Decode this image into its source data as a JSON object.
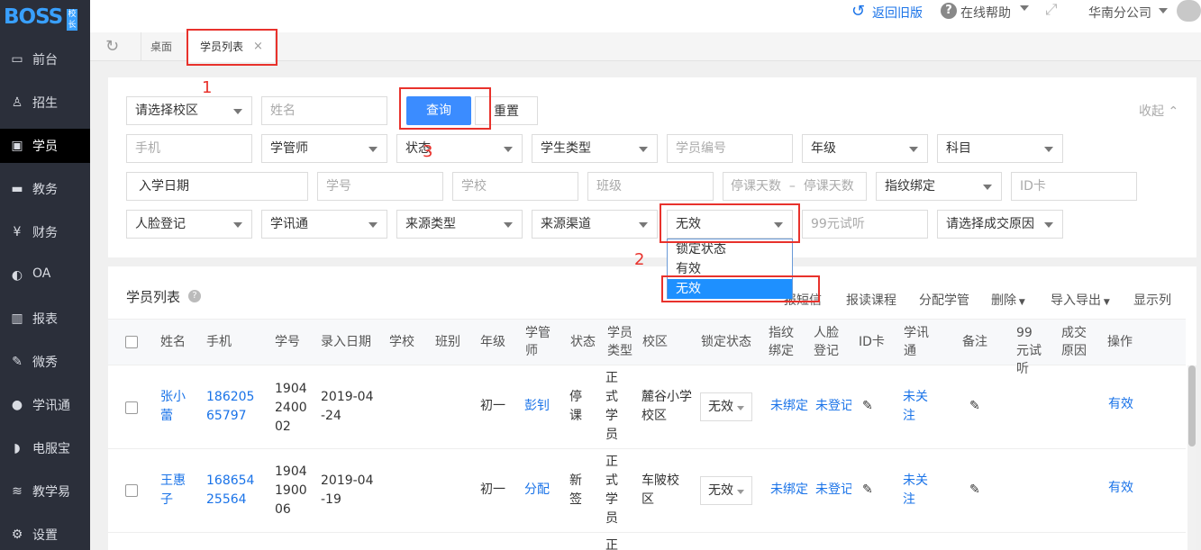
{
  "app": {
    "logo": "BOSS",
    "logo_tag": "校长"
  },
  "sidebar": {
    "items": [
      {
        "label": "前台",
        "icon": "calendar-icon"
      },
      {
        "label": "招生",
        "icon": "user-add-icon"
      },
      {
        "label": "学员",
        "icon": "id-card-icon"
      },
      {
        "label": "教务",
        "icon": "board-icon"
      },
      {
        "label": "财务",
        "icon": "yen-icon"
      },
      {
        "label": "OA",
        "icon": "toggle-icon"
      },
      {
        "label": "报表",
        "icon": "bar-chart-icon"
      },
      {
        "label": "微秀",
        "icon": "show-icon"
      },
      {
        "label": "学讯通",
        "icon": "location-icon"
      },
      {
        "label": "电服宝",
        "icon": "headset-icon"
      },
      {
        "label": "教学易",
        "icon": "teach-icon"
      },
      {
        "label": "设置",
        "icon": "gear-icon"
      }
    ]
  },
  "topbar": {
    "back": "返回旧版",
    "help": "在线帮助",
    "company": "华南分公司"
  },
  "tabs": {
    "home": "桌面",
    "current": "学员列表",
    "close": "×"
  },
  "filters": {
    "row1": {
      "school": "请选择校区",
      "name": "姓名",
      "query": "查询",
      "reset": "重置",
      "collapse": "收起"
    },
    "row2": [
      "手机",
      "学管师",
      "状态",
      "学生类型",
      "学员编号",
      "年级",
      "科目"
    ],
    "row3": {
      "entry_date": "入学日期",
      "no": "学号",
      "school": "学校",
      "class": "班级",
      "stop_from": "停课天数",
      "dash": "–",
      "stop_to": "停课天数",
      "fingerprint": "指纹绑定",
      "idcard": "ID卡"
    },
    "row4": {
      "face": "人脸登记",
      "xxt": "学讯通",
      "source_type": "来源类型",
      "source_channel": "来源渠道",
      "lock_selected": "无效",
      "trial": "99元试听",
      "reason": "请选择成交原因"
    },
    "lock_options": [
      "锁定状态",
      "有效",
      "无效"
    ]
  },
  "annotations": {
    "n1": "1",
    "n2": "2",
    "n3": "3"
  },
  "list": {
    "title": "学员列表",
    "help": "?",
    "toolbar": {
      "partial_label": "报短信",
      "enroll": "报读课程",
      "assign": "分配学管",
      "delete": "删除",
      "import": "导入导出",
      "columns": "显示列"
    },
    "headers": [
      "姓名",
      "手机",
      "学号",
      "录入日期",
      "学校",
      "班别",
      "年级",
      "学管师",
      "状态",
      "学员类型",
      "校区",
      "锁定状态",
      "指纹绑定",
      "人脸登记",
      "ID卡",
      "学讯通",
      "备注",
      "99元试听",
      "成交原因",
      "操作"
    ],
    "rows": [
      {
        "name": "张小蕾",
        "phone": "18620565797",
        "no": "1904240002",
        "date": "2019-04-24",
        "grade": "初一",
        "manager": "彭钊",
        "status": "停课",
        "type": "正式学员",
        "campus": "麓谷小学校区",
        "lock": "无效",
        "finger": "未绑定",
        "face": "未登记",
        "xxt": "未关注",
        "action": "有效"
      },
      {
        "name": "王惠子",
        "phone": "16865425564",
        "no": "1904190006",
        "date": "2019-04-19",
        "grade": "初一",
        "manager": "分配",
        "status": "新签",
        "type": "正式学员",
        "campus": "车陂校区",
        "lock": "无效",
        "finger": "未绑定",
        "face": "未登记",
        "xxt": "未关注",
        "action": "有效"
      },
      {
        "type_partial": "正"
      }
    ]
  },
  "colors": {
    "accent": "#3b8cff",
    "sidebar": "#2b2f3a",
    "annotation": "#e8322c"
  }
}
